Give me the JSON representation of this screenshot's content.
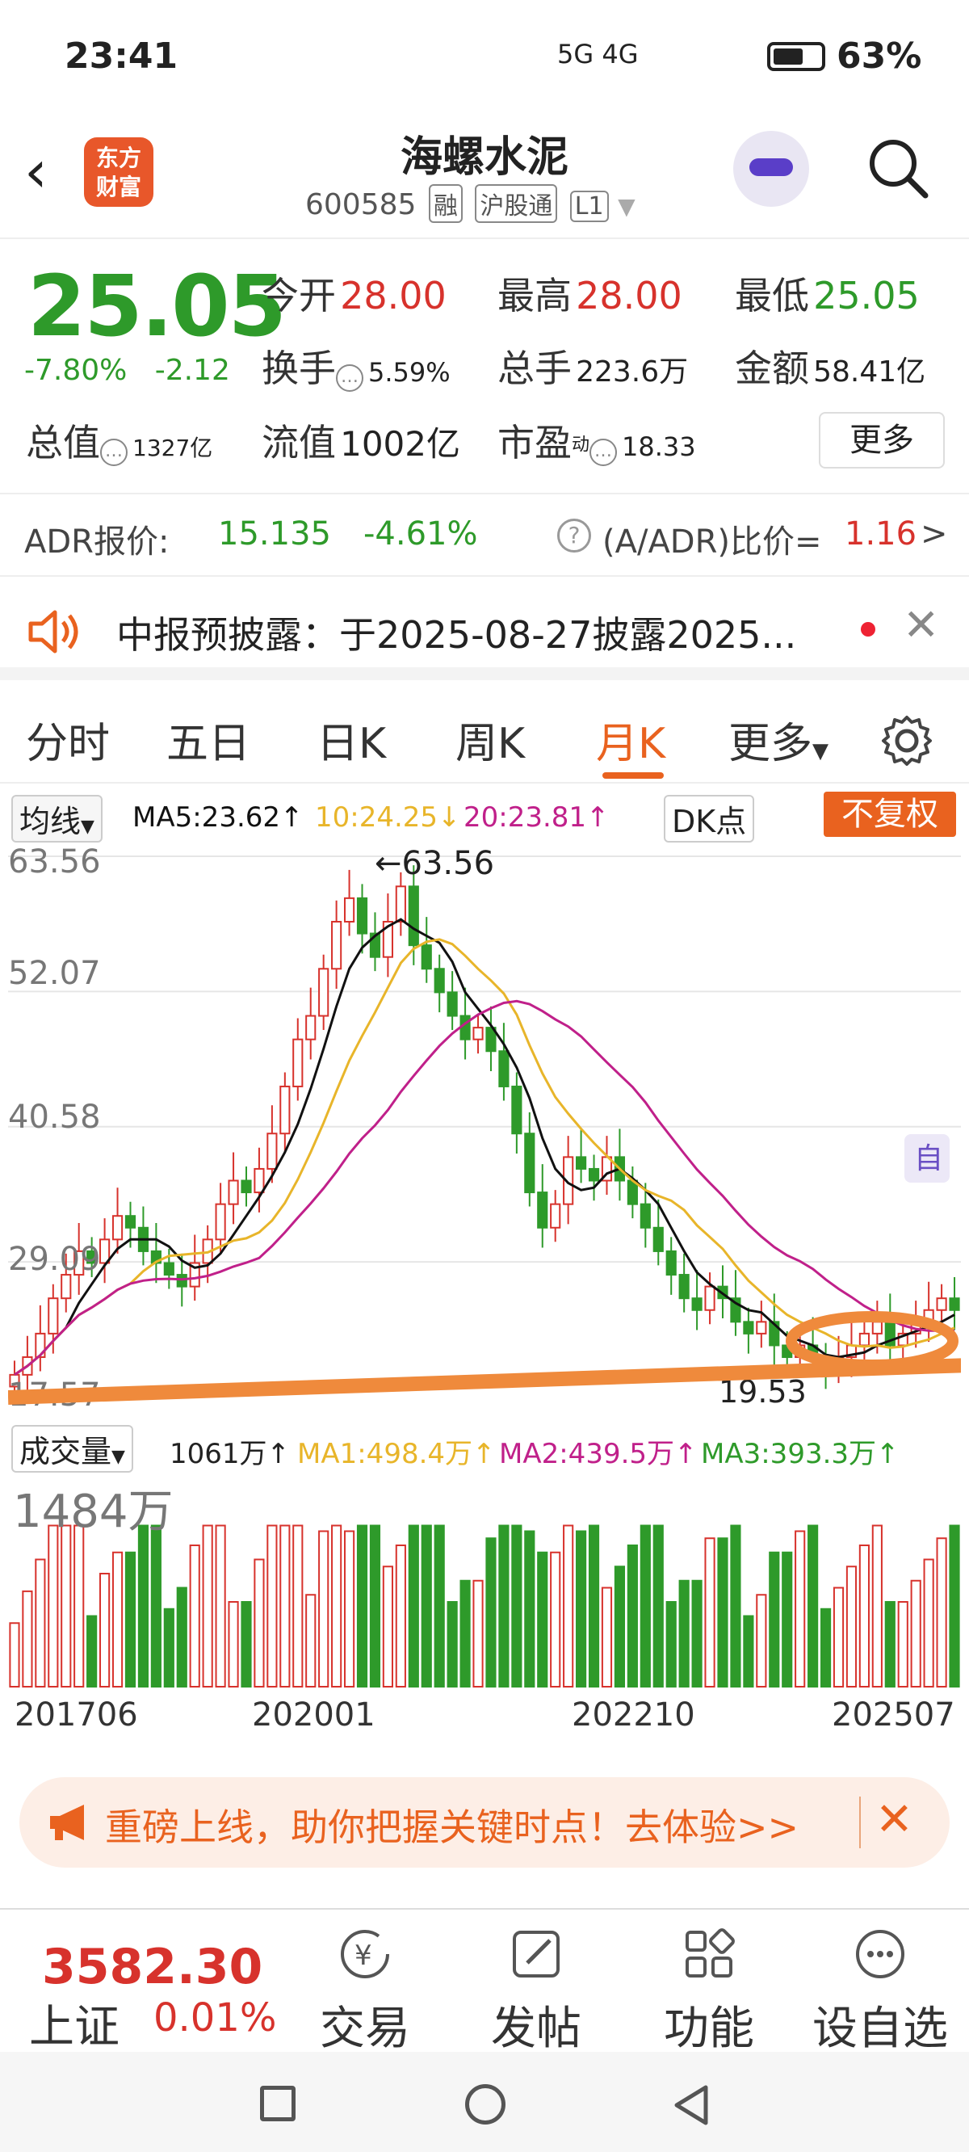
{
  "status": {
    "time": "23:41",
    "network": "5G 4G",
    "battery": "63%"
  },
  "header": {
    "title": "海螺水泥",
    "code": "600585",
    "tags": [
      "融",
      "沪股通",
      "L1"
    ],
    "logo": "东方财富"
  },
  "quote": {
    "price": "25.05",
    "change_pct": "-7.80%",
    "change": "-2.12",
    "open_label": "今开",
    "open": "28.00",
    "high_label": "最高",
    "high": "28.00",
    "low_label": "最低",
    "low": "25.05",
    "turnover_label": "换手",
    "turnover": "5.59%",
    "volume_label": "总手",
    "volume": "223.6万",
    "amount_label": "金额",
    "amount": "58.41亿",
    "mktcap_label": "总值",
    "mktcap": "1327亿",
    "float_label": "流值",
    "float": "1002亿",
    "pe_label": "市盈",
    "pe_sup": "动",
    "pe": "18.33",
    "more_label": "更多"
  },
  "adr": {
    "label": "ADR报价:",
    "price": "15.135",
    "pct": "-4.61%",
    "ratio_label": "(A/ADR)比价=",
    "ratio": "1.16"
  },
  "notice": {
    "text": "中报预披露：于2025-08-27披露2025..."
  },
  "tabs": [
    "分时",
    "五日",
    "日K",
    "周K",
    "月K",
    "更多"
  ],
  "chart_toolbar": {
    "ma_selector": "均线",
    "ma5": "MA5:23.62↑",
    "ma10": "10:24.25↓",
    "ma20": "20:23.81↑",
    "dk": "DK点",
    "fq": "不复权"
  },
  "chart_data": {
    "type": "candlestick",
    "period": "monthly",
    "y_ticks": [
      "63.56",
      "52.07",
      "40.58",
      "29.09",
      "17.57"
    ],
    "ylim": [
      17.57,
      63.56
    ],
    "max_annotation": "←63.56",
    "min_annotation": "19.53",
    "marker": "自",
    "closes": [
      19.5,
      21,
      23,
      26,
      28,
      30,
      29,
      31,
      33,
      32,
      30,
      29,
      28,
      27,
      29,
      31,
      34,
      36,
      35,
      37,
      40,
      44,
      48,
      50,
      54,
      58,
      60,
      57,
      55,
      58,
      61,
      56,
      54,
      52,
      50,
      48,
      49,
      47,
      44,
      40,
      35,
      32,
      34,
      38,
      37,
      36,
      38,
      36,
      34,
      32,
      30,
      28,
      26,
      25,
      27,
      26,
      24,
      23,
      24,
      22,
      21,
      22,
      21,
      20,
      21,
      22,
      23,
      24,
      22,
      23,
      24,
      25,
      26,
      25
    ]
  },
  "volume_toolbar": {
    "selector": "成交量",
    "vol": "1061万↑",
    "ma1": "MA1:498.4万↑",
    "ma2": "MA2:439.5万↑",
    "ma3": "MA3:393.3万↑",
    "max_label": "1484万"
  },
  "date_axis": [
    "201706",
    "202001",
    "202210",
    "202507"
  ],
  "banner": {
    "text": "重磅上线，助你把握关键时点！去体验>>"
  },
  "bottom_nav": {
    "index_value": "3582.30",
    "index_name": "上证",
    "index_change": "0.01%",
    "items": [
      "交易",
      "发帖",
      "功能",
      "设自选"
    ]
  },
  "colors": {
    "up": "#d7322c",
    "down": "#2e9a2a",
    "accent": "#e9621f",
    "ma5": "#111111",
    "ma10": "#e8b52a",
    "ma20": "#c0208a"
  }
}
